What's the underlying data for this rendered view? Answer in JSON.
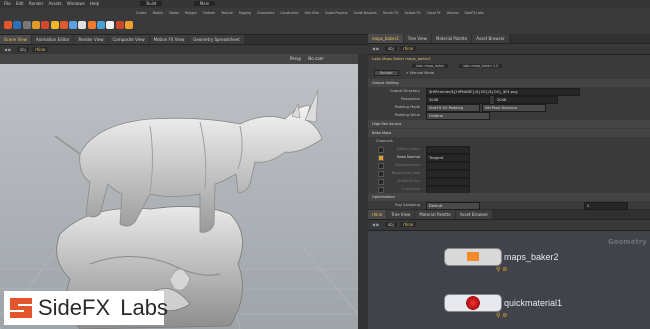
{
  "menu": [
    "File",
    "Edit",
    "Render",
    "Assets",
    "Windows",
    "Help"
  ],
  "shelf": {
    "build_dropdown": "Build",
    "main_dropdown": "Main",
    "shelf_tabs": [
      "Create",
      "Modify",
      "Model",
      "Polygon",
      "Deform",
      "Texture",
      "Rigging",
      "Characters",
      "Constraints",
      "Hair Utils",
      "Guide Process",
      "Guide Brushes",
      "Terrain FX",
      "Simple FX",
      "Cloud FX",
      "Volume",
      "SideFX Labs"
    ],
    "icon_colors": [
      "#e2562a",
      "#2d6fb8",
      "#777777",
      "#e29a2a",
      "#d04a30",
      "#f0b82a",
      "#e05a2a",
      "#5aa0e0",
      "#e0e0e0",
      "#f07a2a",
      "#4aa0d0",
      "#f0f0f0",
      "#c84a2a",
      "#f0a030"
    ]
  },
  "viewport": {
    "tabs": [
      "Scene View",
      "Animation Editor",
      "Render View",
      "Composite View",
      "Motion FX View",
      "Geometry Spreadsheet"
    ],
    "path": "obj",
    "object": "rhino",
    "view_label": "Persp",
    "cam_label": "No cam"
  },
  "params": {
    "tabs": [
      "maps_baker2",
      "Tree View",
      "Material Palette",
      "Asset Browser"
    ],
    "node_title": "Labs Maps Baker  maps_baker2",
    "path": "obj",
    "object": "rhino",
    "subtabs": [
      "labs::maps_baker",
      "labs::maps_baker::1.0"
    ],
    "render_button": "Render",
    "manual_mode_label": "Manual Mode",
    "section_output": "Output Setting",
    "rows": [
      {
        "label": "Output Directory",
        "value": "$HIP/render/${HIPNAME}/${OS}/${OS}_$F4.png"
      },
      {
        "label": "Resolution",
        "value": "2048",
        "value2": "2048"
      },
      {
        "label": "Padding Mode",
        "value": "SideFX UV Padding",
        "value2": "Set Pixel Distance"
      },
      {
        "label": "Padding Value",
        "value": "Uniform"
      }
    ],
    "section_hi": "High Res Source",
    "section_bake": "Bake Maps",
    "section_bake_sub": "Channels",
    "bake_rows": [
      {
        "label": "Diffuse Color",
        "on": false
      },
      {
        "label": "Base Normal",
        "on": true,
        "value": "Tangent"
      },
      {
        "label": "Displacement",
        "on": false
      },
      {
        "label": "Roughness Map",
        "on": false
      },
      {
        "label": "Ambient Occ",
        "on": false
      },
      {
        "label": "Curvature",
        "on": false
      }
    ],
    "section_opt": "Optimization",
    "opt_rows": [
      {
        "label": "Ray Sampling",
        "value": "Default",
        "value2": "2"
      }
    ]
  },
  "network": {
    "tabs": [
      "rhino",
      "Tree View",
      "Material Palette",
      "Asset Browser"
    ],
    "path": "obj",
    "object": "rhino",
    "context_label": "Geometry",
    "nodes": [
      {
        "name": "maps_baker2"
      },
      {
        "name": "quickmaterial1"
      }
    ]
  },
  "logo": {
    "text_a": "SideFX",
    "text_b": "Labs",
    "color": "#e3552a"
  }
}
